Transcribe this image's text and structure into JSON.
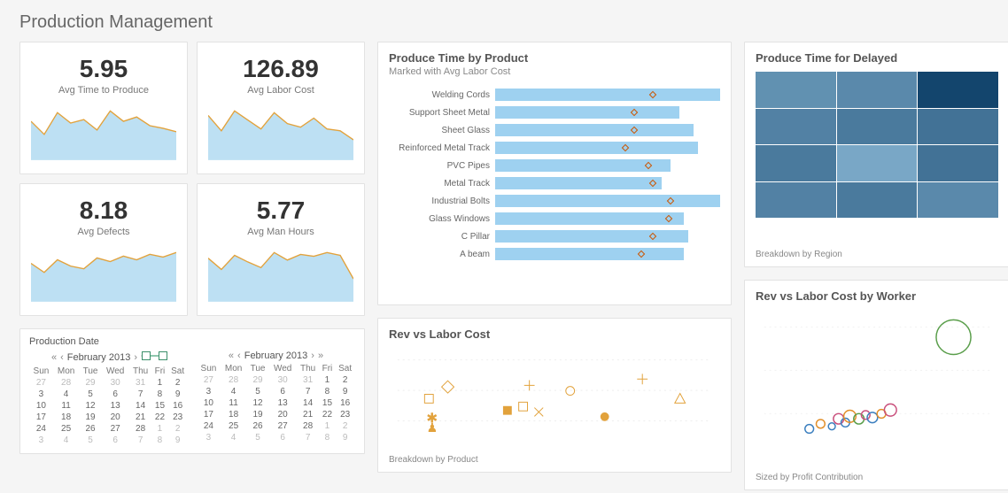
{
  "title": "Production Management",
  "kpis": [
    {
      "value": "5.95",
      "label": "Avg Time to Produce"
    },
    {
      "value": "126.89",
      "label": "Avg Labor Cost"
    },
    {
      "value": "8.18",
      "label": "Avg Defects"
    },
    {
      "value": "5.77",
      "label": "Avg Man Hours"
    }
  ],
  "bar_chart": {
    "title": "Produce Time by Product",
    "subtitle": "Marked with Avg Labor Cost"
  },
  "scatter": {
    "title": "Rev vs Labor Cost",
    "footer": "Breakdown by Product"
  },
  "heatmap": {
    "title": "Produce Time for Delayed",
    "footer": "Breakdown by Region"
  },
  "worker": {
    "title": "Rev vs Labor Cost by Worker",
    "footer": "Sized by Profit Contribution"
  },
  "calendar": {
    "title": "Production Date",
    "month": "February 2013",
    "days": [
      "Sun",
      "Mon",
      "Tue",
      "Wed",
      "Thu",
      "Fri",
      "Sat"
    ]
  },
  "chart_data": {
    "kpis_sparklines": [
      {
        "name": "Avg Time to Produce",
        "y": [
          40,
          25,
          50,
          38,
          42,
          30,
          52,
          40,
          45,
          35,
          32,
          28
        ]
      },
      {
        "name": "Avg Labor Cost",
        "y": [
          45,
          28,
          50,
          40,
          30,
          48,
          36,
          32,
          42,
          30,
          28,
          18
        ]
      },
      {
        "name": "Avg Defects",
        "y": [
          38,
          28,
          42,
          35,
          32,
          44,
          40,
          46,
          42,
          48,
          45,
          50
        ]
      },
      {
        "name": "Avg Man Hours",
        "y": [
          42,
          30,
          45,
          38,
          32,
          48,
          40,
          46,
          44,
          48,
          45,
          20
        ]
      }
    ],
    "produce_time_by_product": {
      "type": "bar",
      "xlabel": "",
      "ylabel": "",
      "categories": [
        "Welding Cords",
        "Support Sheet Metal",
        "Sheet Glass",
        "Reinforced Metal Track",
        "PVC Pipes",
        "Metal Track",
        "Industrial Bolts",
        "Glass Windows",
        "C Pillar",
        "A beam"
      ],
      "series": [
        {
          "name": "Produce Time",
          "values": [
            100,
            82,
            88,
            90,
            78,
            74,
            100,
            84,
            86,
            84
          ]
        },
        {
          "name": "Avg Labor Cost (mark)",
          "values": [
            70,
            62,
            62,
            58,
            68,
            70,
            78,
            77,
            70,
            65
          ]
        }
      ],
      "xlim": [
        0,
        100
      ]
    },
    "rev_vs_labor_cost": {
      "type": "scatter",
      "title": "Rev vs Labor Cost",
      "points": [
        {
          "shape": "square",
          "x": 0.1,
          "y": 0.55
        },
        {
          "shape": "diamond",
          "x": 0.16,
          "y": 0.4
        },
        {
          "shape": "star",
          "x": 0.11,
          "y": 0.8
        },
        {
          "shape": "trophy",
          "x": 0.11,
          "y": 0.92
        },
        {
          "shape": "square-f",
          "x": 0.35,
          "y": 0.7
        },
        {
          "shape": "square",
          "x": 0.4,
          "y": 0.65
        },
        {
          "shape": "cross",
          "x": 0.45,
          "y": 0.72
        },
        {
          "shape": "plus",
          "x": 0.42,
          "y": 0.38
        },
        {
          "shape": "circle",
          "x": 0.55,
          "y": 0.45
        },
        {
          "shape": "circle-f",
          "x": 0.66,
          "y": 0.78
        },
        {
          "shape": "plus",
          "x": 0.78,
          "y": 0.3
        },
        {
          "shape": "triangle",
          "x": 0.9,
          "y": 0.55
        }
      ]
    },
    "produce_time_for_delayed": {
      "type": "heatmap",
      "rows": 4,
      "cols": 3,
      "values": [
        [
          0.45,
          0.5,
          0.95
        ],
        [
          0.55,
          0.6,
          0.65
        ],
        [
          0.6,
          0.3,
          0.65
        ],
        [
          0.55,
          0.6,
          0.5
        ]
      ],
      "color_low": "#a8d5ef",
      "color_high": "#0b3d66"
    },
    "rev_vs_labor_cost_by_worker": {
      "type": "scatter",
      "points": [
        {
          "x": 0.84,
          "y": 0.15,
          "r": 20,
          "color": "#5a9e4b"
        },
        {
          "x": 0.2,
          "y": 0.88,
          "r": 5,
          "color": "#3b7fbf"
        },
        {
          "x": 0.25,
          "y": 0.84,
          "r": 5,
          "color": "#e28f2a"
        },
        {
          "x": 0.3,
          "y": 0.86,
          "r": 4,
          "color": "#3b7fbf"
        },
        {
          "x": 0.33,
          "y": 0.8,
          "r": 6,
          "color": "#c94f7c"
        },
        {
          "x": 0.36,
          "y": 0.83,
          "r": 5,
          "color": "#3b7fbf"
        },
        {
          "x": 0.38,
          "y": 0.78,
          "r": 7,
          "color": "#e28f2a"
        },
        {
          "x": 0.42,
          "y": 0.8,
          "r": 6,
          "color": "#5a9e4b"
        },
        {
          "x": 0.45,
          "y": 0.77,
          "r": 5,
          "color": "#c94f7c"
        },
        {
          "x": 0.48,
          "y": 0.79,
          "r": 6,
          "color": "#3b7fbf"
        },
        {
          "x": 0.52,
          "y": 0.76,
          "r": 5,
          "color": "#e28f2a"
        },
        {
          "x": 0.56,
          "y": 0.73,
          "r": 7,
          "color": "#c94f7c"
        }
      ]
    },
    "calendar": {
      "month_label": "February 2013",
      "weeks": [
        [
          27,
          28,
          29,
          30,
          31,
          1,
          2
        ],
        [
          3,
          4,
          5,
          6,
          7,
          8,
          9
        ],
        [
          10,
          11,
          12,
          13,
          14,
          15,
          16
        ],
        [
          17,
          18,
          19,
          20,
          21,
          22,
          23
        ],
        [
          24,
          25,
          26,
          27,
          28,
          1,
          2
        ],
        [
          3,
          4,
          5,
          6,
          7,
          8,
          9
        ]
      ],
      "dim_first_row_until": 5,
      "dim_last_rows_from": {
        "row": 4,
        "col": 5
      }
    }
  }
}
